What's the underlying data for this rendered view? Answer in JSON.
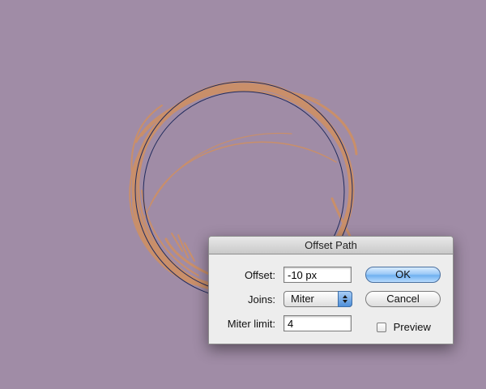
{
  "dialog": {
    "title": "Offset Path",
    "offset_label": "Offset:",
    "offset_value": "-10 px",
    "joins_label": "Joins:",
    "joins_value": "Miter",
    "miter_label": "Miter limit:",
    "miter_value": "4",
    "ok_label": "OK",
    "cancel_label": "Cancel",
    "preview_label": "Preview",
    "preview_checked": false
  },
  "colors": {
    "background": "#a08ca6",
    "stroke": "#c98f6a",
    "path": "#1f2a5c",
    "accent": "#6fb0f0"
  },
  "icons": [
    "popup-arrows-icon",
    "checkbox-icon"
  ]
}
